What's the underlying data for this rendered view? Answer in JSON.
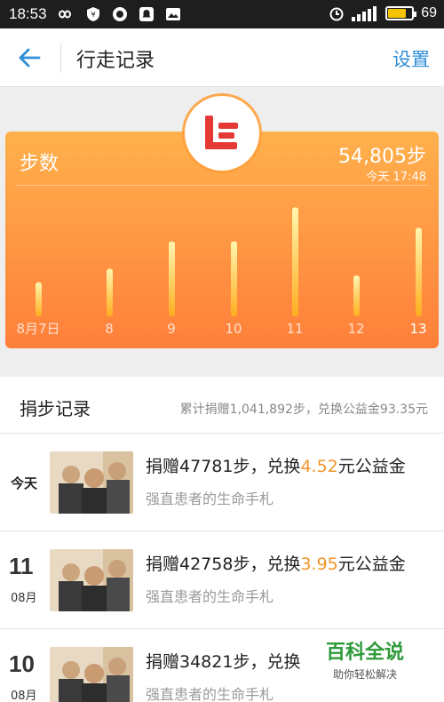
{
  "status_bar": {
    "time": "18:53",
    "battery": "69"
  },
  "nav": {
    "title": "行走记录",
    "action": "设置"
  },
  "hero": {
    "label": "步数",
    "total_steps": "54,805步",
    "time_label": "今天 17:48"
  },
  "chart_data": {
    "type": "bar",
    "categories": [
      "8月7日",
      "8",
      "9",
      "10",
      "11",
      "12",
      "13"
    ],
    "values": [
      5,
      7,
      11,
      11,
      16,
      6,
      13
    ],
    "ylim": [
      0,
      18
    ],
    "grid": false,
    "colors": {
      "bar": "#fff3a6",
      "bar_bottom": "#ffb020"
    }
  },
  "records": {
    "title": "捐步记录",
    "summary": "累计捐赠1,041,892步，兑换公益金93.35元",
    "items": [
      {
        "day": "今天",
        "month": "",
        "prefix": "捐赠47781步，兑换",
        "amount": "4.52",
        "suffix": "元公益金",
        "project": "强直患者的生命手札"
      },
      {
        "day": "11",
        "month": "08月",
        "prefix": "捐赠42758步，兑换",
        "amount": "3.95",
        "suffix": "元公益金",
        "project": "强直患者的生命手札"
      },
      {
        "day": "10",
        "month": "08月",
        "prefix": "捐赠34821步，兑换",
        "amount": "",
        "suffix": "",
        "project": "强直患者的生命手札"
      }
    ]
  },
  "watermark": {
    "main": "百科全说",
    "sub": "助你轻松解决"
  },
  "colors": {
    "accent": "#2f8fd8",
    "orange": "#ff9a45",
    "amount": "#f0962a"
  }
}
